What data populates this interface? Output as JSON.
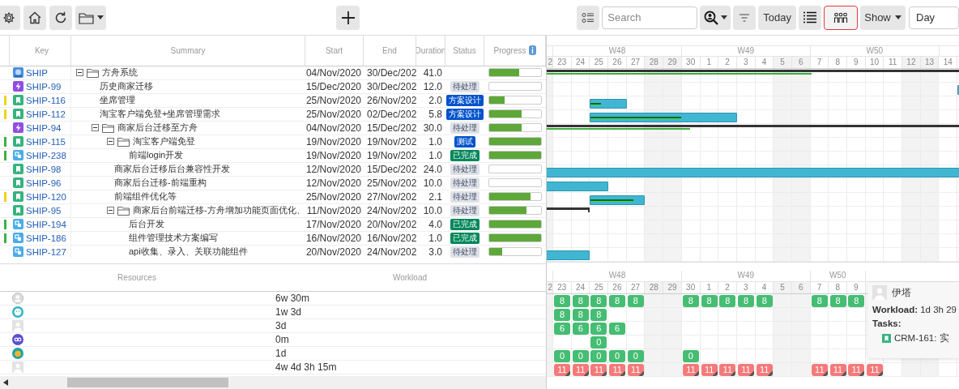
{
  "toolbar": {
    "left": [
      {
        "kind": "settings"
      },
      {
        "kind": "home"
      },
      {
        "kind": "refresh"
      },
      {
        "kind": "folder-menu"
      }
    ],
    "add": {
      "kind": "plus"
    },
    "right": [
      {
        "kind": "legend",
        "highlighted": false
      },
      {
        "kind": "search",
        "placeholder": "Search",
        "highlighted": false
      },
      {
        "kind": "user-filter",
        "highlighted": false
      },
      {
        "kind": "filter",
        "highlighted": false
      },
      {
        "kind": "text",
        "label": "Today",
        "highlighted": false
      },
      {
        "kind": "list-view",
        "highlighted": false
      },
      {
        "kind": "resource-view",
        "highlighted": true
      },
      {
        "kind": "dropdown",
        "label": "Show",
        "highlighted": false
      },
      {
        "kind": "select",
        "value": "Day",
        "highlighted": false
      }
    ]
  },
  "tasks": {
    "columns": [
      "Key",
      "Summary",
      "Start",
      "End",
      "Duration",
      "Status",
      "Progress"
    ],
    "rows": [
      {
        "key": "SHIP",
        "kind": "project",
        "summary": "方舟系统",
        "start": "04/Nov/2020",
        "end": "30/Dec/202",
        "duration": "41.0",
        "level": 0.58,
        "expanded": true,
        "children": [
          {
            "key": "SHIP-99",
            "kind": "epic",
            "summary": "历史商家迁移",
            "start": "15/Dec/2020",
            "end": "30/Dec/202",
            "duration": "12.0",
            "status": {
              "label": "待处理",
              "kind": "todo"
            },
            "level": 0
          },
          {
            "key": "SHIP-116",
            "kind": "story",
            "color": "#f2d21a",
            "summary": "坐席管理",
            "start": "25/Nov/2020",
            "end": "26/Nov/202",
            "duration": "2.0",
            "status": {
              "label": "方案设计",
              "kind": "design"
            },
            "level": 0.3
          },
          {
            "key": "SHIP-112",
            "kind": "story",
            "color": "#f2d21a",
            "summary": "淘宝客户端免登+坐席管理需求",
            "start": "25/Nov/2020",
            "end": "02/Dec/202",
            "duration": "5.8",
            "status": {
              "label": "方案设计",
              "kind": "design"
            },
            "level": 0.62
          },
          {
            "key": "SHIP-94",
            "kind": "epic",
            "summary": "商家后台迁移至方舟",
            "start": "04/Nov/2020",
            "end": "15/Dec/202",
            "duration": "30.0",
            "status": {
              "label": "待处理",
              "kind": "todo"
            },
            "level": 0.63,
            "expanded": true,
            "children": [
              {
                "key": "SHIP-115",
                "kind": "story",
                "color": "#3cb043",
                "summary": "淘宝客户端免登",
                "start": "19/Nov/2020",
                "end": "19/Nov/202",
                "duration": "1.0",
                "status": {
                  "label": "测试",
                  "kind": "test"
                },
                "level": 1,
                "expanded": true,
                "children": [
                  {
                    "key": "SHIP-238",
                    "kind": "subtask",
                    "color": "#3cb043",
                    "summary": "前端login开发",
                    "start": "19/Nov/2020",
                    "end": "19/Nov/202",
                    "duration": "1.0",
                    "status": {
                      "label": "已完成",
                      "kind": "done"
                    },
                    "level": 1
                  }
                ]
              },
              {
                "key": "SHIP-98",
                "kind": "story",
                "summary": "商家后台迁移后台兼容性开发",
                "start": "12/Nov/2020",
                "end": "15/Dec/202",
                "duration": "24.0",
                "status": {
                  "label": "待处理",
                  "kind": "todo"
                },
                "level": 0
              },
              {
                "key": "SHIP-96",
                "kind": "story",
                "summary": "商家后台迁移-前端重构",
                "start": "12/Nov/2020",
                "end": "25/Nov/202",
                "duration": "10.0",
                "status": {
                  "label": "待处理",
                  "kind": "todo"
                },
                "level": 0
              },
              {
                "key": "SHIP-120",
                "kind": "story",
                "color": "#f2d21a",
                "summary": "前端组件优化等",
                "start": "25/Nov/2020",
                "end": "27/Nov/202",
                "duration": "2.1",
                "status": {
                  "label": "待处理",
                  "kind": "todo"
                },
                "level": 0.8
              },
              {
                "key": "SHIP-95",
                "kind": "story",
                "summary": "商家后台前端迁移-方舟增加功能页面优化、",
                "start": "11/Nov/2020",
                "end": "24/Nov/202",
                "duration": "10.0",
                "status": {
                  "label": "待处理",
                  "kind": "todo"
                },
                "level": 0.72,
                "expanded": true,
                "children": [
                  {
                    "key": "SHIP-194",
                    "kind": "subtask",
                    "color": "#3cb043",
                    "summary": "后台开发",
                    "start": "17/Nov/2020",
                    "end": "20/Nov/202",
                    "duration": "4.0",
                    "status": {
                      "label": "已完成",
                      "kind": "done"
                    },
                    "level": 1
                  },
                  {
                    "key": "SHIP-186",
                    "kind": "subtask",
                    "color": "#3cb043",
                    "summary": "组件管理技术方案编写",
                    "start": "16/Nov/2020",
                    "end": "16/Nov/202",
                    "duration": "1.0",
                    "status": {
                      "label": "已完成",
                      "kind": "done"
                    },
                    "level": 1
                  },
                  {
                    "key": "SHIP-127",
                    "kind": "subtask",
                    "summary": "api收集、录入、关联功能组件",
                    "start": "20/Nov/2020",
                    "end": "24/Nov/202",
                    "duration": "3.0",
                    "status": {
                      "label": "待处理",
                      "kind": "todo"
                    },
                    "level": 0.25
                  }
                ]
              }
            ]
          }
        ]
      }
    ]
  },
  "gantt": {
    "timeline": {
      "lead_days": [
        {
          "label": "2",
          "weekend": true
        }
      ],
      "weeks": [
        {
          "label": "W48",
          "days": [
            {
              "label": "23",
              "weekend": false
            },
            {
              "label": "24",
              "weekend": false
            },
            {
              "label": "25",
              "weekend": false
            },
            {
              "label": "26",
              "weekend": false
            },
            {
              "label": "27",
              "weekend": false
            },
            {
              "label": "28",
              "weekend": true
            },
            {
              "label": "29",
              "weekend": true
            }
          ]
        },
        {
          "label": "W49",
          "days": [
            {
              "label": "30",
              "weekend": false
            },
            {
              "label": "1",
              "weekend": false
            },
            {
              "label": "2",
              "weekend": false
            },
            {
              "label": "3",
              "weekend": false
            },
            {
              "label": "4",
              "weekend": false
            },
            {
              "label": "5",
              "weekend": true
            },
            {
              "label": "6",
              "weekend": true
            }
          ]
        },
        {
          "label": "W50",
          "days": [
            {
              "label": "7",
              "weekend": false
            },
            {
              "label": "8",
              "weekend": false
            },
            {
              "label": "9",
              "weekend": false
            },
            {
              "label": "10",
              "weekend": false
            },
            {
              "label": "11",
              "weekend": false
            },
            {
              "label": "12",
              "weekend": true
            },
            {
              "label": "13",
              "weekend": true
            }
          ]
        }
      ],
      "trail_days": [
        {
          "label": "14",
          "weekend": false
        }
      ]
    }
  },
  "resources": {
    "columns": [
      "Resources",
      "Workload"
    ],
    "timeline": {
      "lead_days": [
        {
          "label": "2",
          "weekend": true
        }
      ],
      "weeks": [
        {
          "label": "W48",
          "days": [
            {
              "label": "23",
              "weekend": false
            },
            {
              "label": "24",
              "weekend": false
            },
            {
              "label": "25",
              "weekend": false
            },
            {
              "label": "26",
              "weekend": false
            },
            {
              "label": "27",
              "weekend": false
            },
            {
              "label": "28",
              "weekend": true
            },
            {
              "label": "29",
              "weekend": true
            }
          ]
        },
        {
          "label": "W49",
          "days": [
            {
              "label": "30",
              "weekend": false
            },
            {
              "label": "1",
              "weekend": false
            },
            {
              "label": "2",
              "weekend": false
            },
            {
              "label": "3",
              "weekend": false
            },
            {
              "label": "4",
              "weekend": false
            },
            {
              "label": "5",
              "weekend": true
            },
            {
              "label": "6",
              "weekend": true
            }
          ]
        },
        {
          "label": "W50",
          "days": [
            {
              "label": "7",
              "weekend": false
            },
            {
              "label": "8",
              "weekend": false
            },
            {
              "label": "9",
              "weekend": false
            }
          ]
        }
      ]
    },
    "rows": [
      {
        "kind": "person-circle",
        "workload": "6w 30m",
        "overloaded": false,
        "cells": [
          null,
          "8",
          "8",
          "8",
          "8",
          "8",
          null,
          null,
          "8",
          "8",
          "8",
          "8",
          "8",
          null,
          null,
          "8",
          "8",
          "8"
        ]
      },
      {
        "kind": "smiley",
        "workload": "1w 3d",
        "overloaded": false,
        "cells": [
          null,
          "8",
          "8",
          "8"
        ]
      },
      {
        "kind": "person-square",
        "workload": "3d",
        "overloaded": false,
        "cells": [
          null,
          "6",
          "6",
          "6",
          "6"
        ]
      },
      {
        "kind": "infinity",
        "workload": "0m",
        "overloaded": false,
        "cells": [
          null,
          null,
          null,
          "0"
        ]
      },
      {
        "kind": "emoji",
        "workload": "1d",
        "overloaded": false,
        "cells": [
          null,
          "0",
          "0",
          "0",
          "0",
          "0",
          null,
          null,
          "0"
        ]
      },
      {
        "kind": "person-square",
        "workload": "4w 4d 3h 15m",
        "overloaded": true,
        "cells": [
          null,
          "11",
          "11",
          "11",
          "11",
          "11",
          null,
          null,
          "11",
          "11",
          "11",
          "11",
          "11",
          null,
          null,
          "11",
          "11",
          "11",
          "11"
        ]
      }
    ],
    "tooltip": {
      "kind": "person-square",
      "name": "伊塔",
      "workload": "**Workload:** 1d 3h 29",
      "tasks_label": "Tasks:",
      "tasks": [
        {
          "kind": "story",
          "text": "CRM-161: 实"
        }
      ]
    }
  }
}
